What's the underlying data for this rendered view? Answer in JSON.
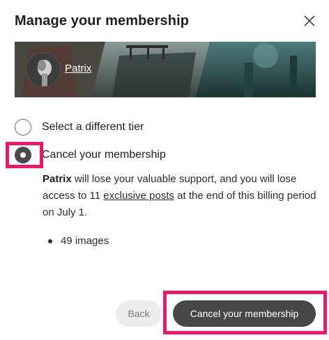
{
  "dialog": {
    "title": "Manage your membership",
    "close_icon": "close-icon"
  },
  "creator": {
    "name": "Patrix",
    "avatar_icon": "avatar-image"
  },
  "options": [
    {
      "label": "Select a different tier",
      "checked": false
    },
    {
      "label": "Cancel your membership",
      "checked": true
    }
  ],
  "description": {
    "creator_name": "Patrix",
    "text_part1": " will lose your valuable support, and you will lose access to 11 ",
    "link_text": "exclusive posts",
    "text_part2": " at the end of this billing period on July 1."
  },
  "benefits": [
    "49 images"
  ],
  "buttons": {
    "back_label": "Back",
    "cancel_label": "Cancel your membership"
  },
  "colors": {
    "highlight": "#e8196b",
    "primary_button": "#474747",
    "secondary_button": "#ececec"
  }
}
